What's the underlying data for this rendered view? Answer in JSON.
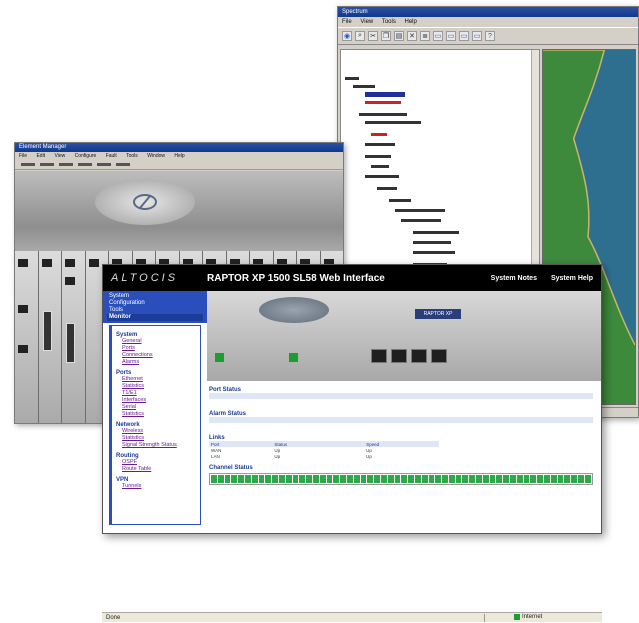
{
  "map_window": {
    "title": "Spectrum",
    "menu": [
      "File",
      "View",
      "Tools",
      "Help"
    ],
    "toolbar_icons": [
      "globe-icon",
      "search-icon",
      "cut-icon",
      "copy-icon",
      "paste-icon",
      "delete-icon",
      "properties-icon",
      "monitor-icon",
      "monitor-icon",
      "monitor-icon",
      "monitor-icon",
      "help-icon"
    ]
  },
  "chassis_window": {
    "title": "Element Manager",
    "menu": [
      "File",
      "Edit",
      "View",
      "Configure",
      "Fault",
      "Tools",
      "Window",
      "Help"
    ]
  },
  "web_window": {
    "logo": "ALTOCIS",
    "title": "RAPTOR XP 1500 SL58 Web Interface",
    "links": [
      "System Notes",
      "System Help"
    ],
    "tabs": [
      "System",
      "Configuration",
      "Tools",
      "Monitor"
    ],
    "active_tab": "Monitor",
    "sidebar": {
      "sections": [
        {
          "heading": "System",
          "links": [
            "General",
            "Ports",
            "Connections",
            "Alarms"
          ]
        },
        {
          "heading": "Ports",
          "links": [
            "Ethernet",
            "Statistics",
            "T1/E1",
            "Interfaces",
            "Serial",
            "Statistics"
          ]
        },
        {
          "heading": "Network",
          "links": [
            "Wireless",
            "Statistics",
            "Signal Strength Status"
          ]
        },
        {
          "heading": "Routing",
          "links": [
            "OSPF",
            "Route Table"
          ]
        },
        {
          "heading": "VPN",
          "links": [
            "Tunnels"
          ]
        }
      ]
    },
    "device_badge": "RAPTOR XP",
    "content": {
      "section1": "Port Status",
      "section2": "Alarm Status",
      "section3": "Links",
      "section4": "Channel Status",
      "link_rows": [
        [
          "Port",
          "Status",
          "",
          "Speed"
        ],
        [
          "WAN",
          "Up",
          "",
          "Up"
        ],
        [
          "LAN",
          "Up",
          "",
          "Up"
        ]
      ]
    }
  },
  "browser_status": {
    "left": "Done",
    "right": "Internet"
  }
}
